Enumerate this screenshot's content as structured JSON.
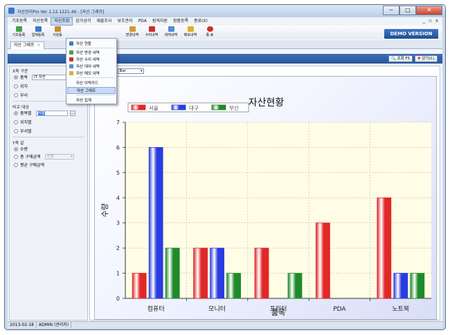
{
  "window": {
    "title": "자산관리Pro Ver 1.12.1221.46 - [자산 그래프]",
    "min_label": "─",
    "max_label": "□",
    "close_label": "✕"
  },
  "menu": {
    "items": [
      "기초등록",
      "자산등록",
      "자산조회",
      "감가상각",
      "재물조사",
      "보조관리",
      "PDA",
      "원격지원",
      "정품등록",
      "종료(X)"
    ],
    "mdi_controls": [
      "_",
      "▫",
      "x"
    ]
  },
  "toolbar": {
    "items": [
      {
        "label": "기초등록",
        "icon": "basic-register-icon",
        "color": "#4aa046"
      },
      {
        "label": "업체등록",
        "icon": "vendor-register-icon",
        "color": "#3c78c8"
      },
      {
        "label": "사원등",
        "icon": "employee-icon",
        "color": "#c88a30"
      },
      {
        "label": "변경내역",
        "icon": "change-history-icon",
        "color": "#d09a3a"
      },
      {
        "label": "수리내역",
        "icon": "repair-history-icon",
        "color": "#cc3030"
      },
      {
        "label": "대여내역",
        "icon": "rental-history-icon",
        "color": "#5a8ad0"
      },
      {
        "label": "메모내역",
        "icon": "memo-history-icon",
        "color": "#e0b030"
      },
      {
        "label": "종 료",
        "icon": "exit-icon",
        "color": "#d03020"
      }
    ],
    "demo_label": "DEMO VERSION"
  },
  "dropdown": {
    "items": [
      {
        "label": "자산 현황",
        "icon": "asset-status-icon",
        "color": "#3c78c8"
      },
      {
        "label": "자산 변경 내역",
        "icon": "asset-change-icon",
        "color": "#4aa046"
      },
      {
        "label": "자산 수리 내역",
        "icon": "asset-repair-icon",
        "color": "#cc3030"
      },
      {
        "label": "자산 대여 내역",
        "icon": "asset-rental-icon",
        "color": "#5a8ad0"
      },
      {
        "label": "자산 메모 내역",
        "icon": "asset-memo-icon",
        "color": "#e0b030"
      },
      {
        "label": "자산 이력카드",
        "icon": "",
        "color": ""
      },
      {
        "label": "자산 그래프",
        "icon": "",
        "color": ""
      },
      {
        "label": "자산 집계",
        "icon": "",
        "color": ""
      }
    ],
    "highlighted_index": 6
  },
  "tab": {
    "label": "자산 그래프",
    "close": "×"
  },
  "actions": {
    "refresh_label": "조회 F5",
    "close_label": "닫기(C)"
  },
  "left_panel": {
    "x_axis": {
      "title": "X축 구분",
      "options": [
        "품목",
        "위치",
        "부서"
      ],
      "selected": 0,
      "item_value": "IT 자산"
    },
    "compare": {
      "title": "비교 대상",
      "options": [
        "품목별",
        "위치별",
        "부서별"
      ],
      "selected": 0,
      "value": "서울"
    },
    "y_axis": {
      "title": "Y축 값",
      "options": [
        "수량",
        "총 구매금액",
        "평균 구매금액"
      ],
      "selected": 0,
      "unit_value": "천원"
    }
  },
  "chart_type": {
    "label": "류:",
    "value": "Bar"
  },
  "status": {
    "date": "2013-02-18",
    "user": "ADMIN (관리자)"
  },
  "chart_data": {
    "type": "bar",
    "title": "자산현황",
    "xlabel": "품목",
    "ylabel": "수량",
    "ylim": [
      0,
      7
    ],
    "yticks": [
      0,
      1,
      2,
      3,
      4,
      5,
      6,
      7
    ],
    "categories": [
      "컴퓨터",
      "모니터",
      "프린터",
      "PDA",
      "노트북"
    ],
    "series": [
      {
        "name": "서울",
        "values": [
          1,
          2,
          2,
          3,
          4
        ],
        "color": "#e02828"
      },
      {
        "name": "대구",
        "values": [
          6,
          2,
          0,
          0,
          1
        ],
        "color": "#2a3ce0"
      },
      {
        "name": "부산",
        "values": [
          2,
          1,
          1,
          0,
          1
        ],
        "color": "#1f8a2a"
      }
    ],
    "grid": true,
    "legend": "top-left"
  }
}
